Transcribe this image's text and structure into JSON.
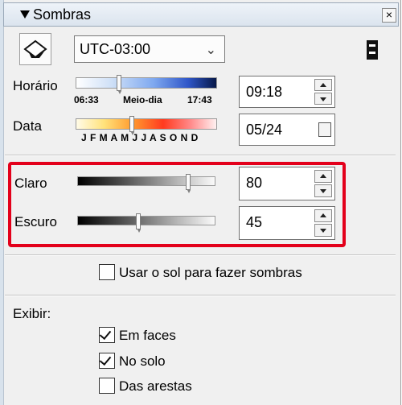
{
  "panel": {
    "title": "Sombras",
    "close_glyph": "×",
    "timezone": {
      "selected": "UTC-03:00"
    }
  },
  "time": {
    "label": "Horário",
    "start": "06:33",
    "mid": "Meio-dia",
    "end": "17:43",
    "value": "09:18"
  },
  "date": {
    "label": "Data",
    "months": "J F M A M J J A S O N D",
    "value": "05/24"
  },
  "light": {
    "label": "Claro",
    "value": "80"
  },
  "dark": {
    "label": "Escuro",
    "value": "45"
  },
  "use_sun": {
    "label": "Usar o sol para fazer sombras",
    "checked": false
  },
  "display": {
    "label": "Exibir:",
    "options": [
      {
        "label": "Em faces",
        "checked": true
      },
      {
        "label": "No solo",
        "checked": true
      },
      {
        "label": "Das arestas",
        "checked": false
      }
    ]
  },
  "colors": {
    "highlight": "#e3001b"
  },
  "icons": [
    "collapse-arrow-icon",
    "close-icon",
    "sun-shadow-icon",
    "chevron-down-icon",
    "details-toggle-icon",
    "calendar-icon",
    "spin-up-icon",
    "spin-down-icon",
    "check-icon"
  ]
}
